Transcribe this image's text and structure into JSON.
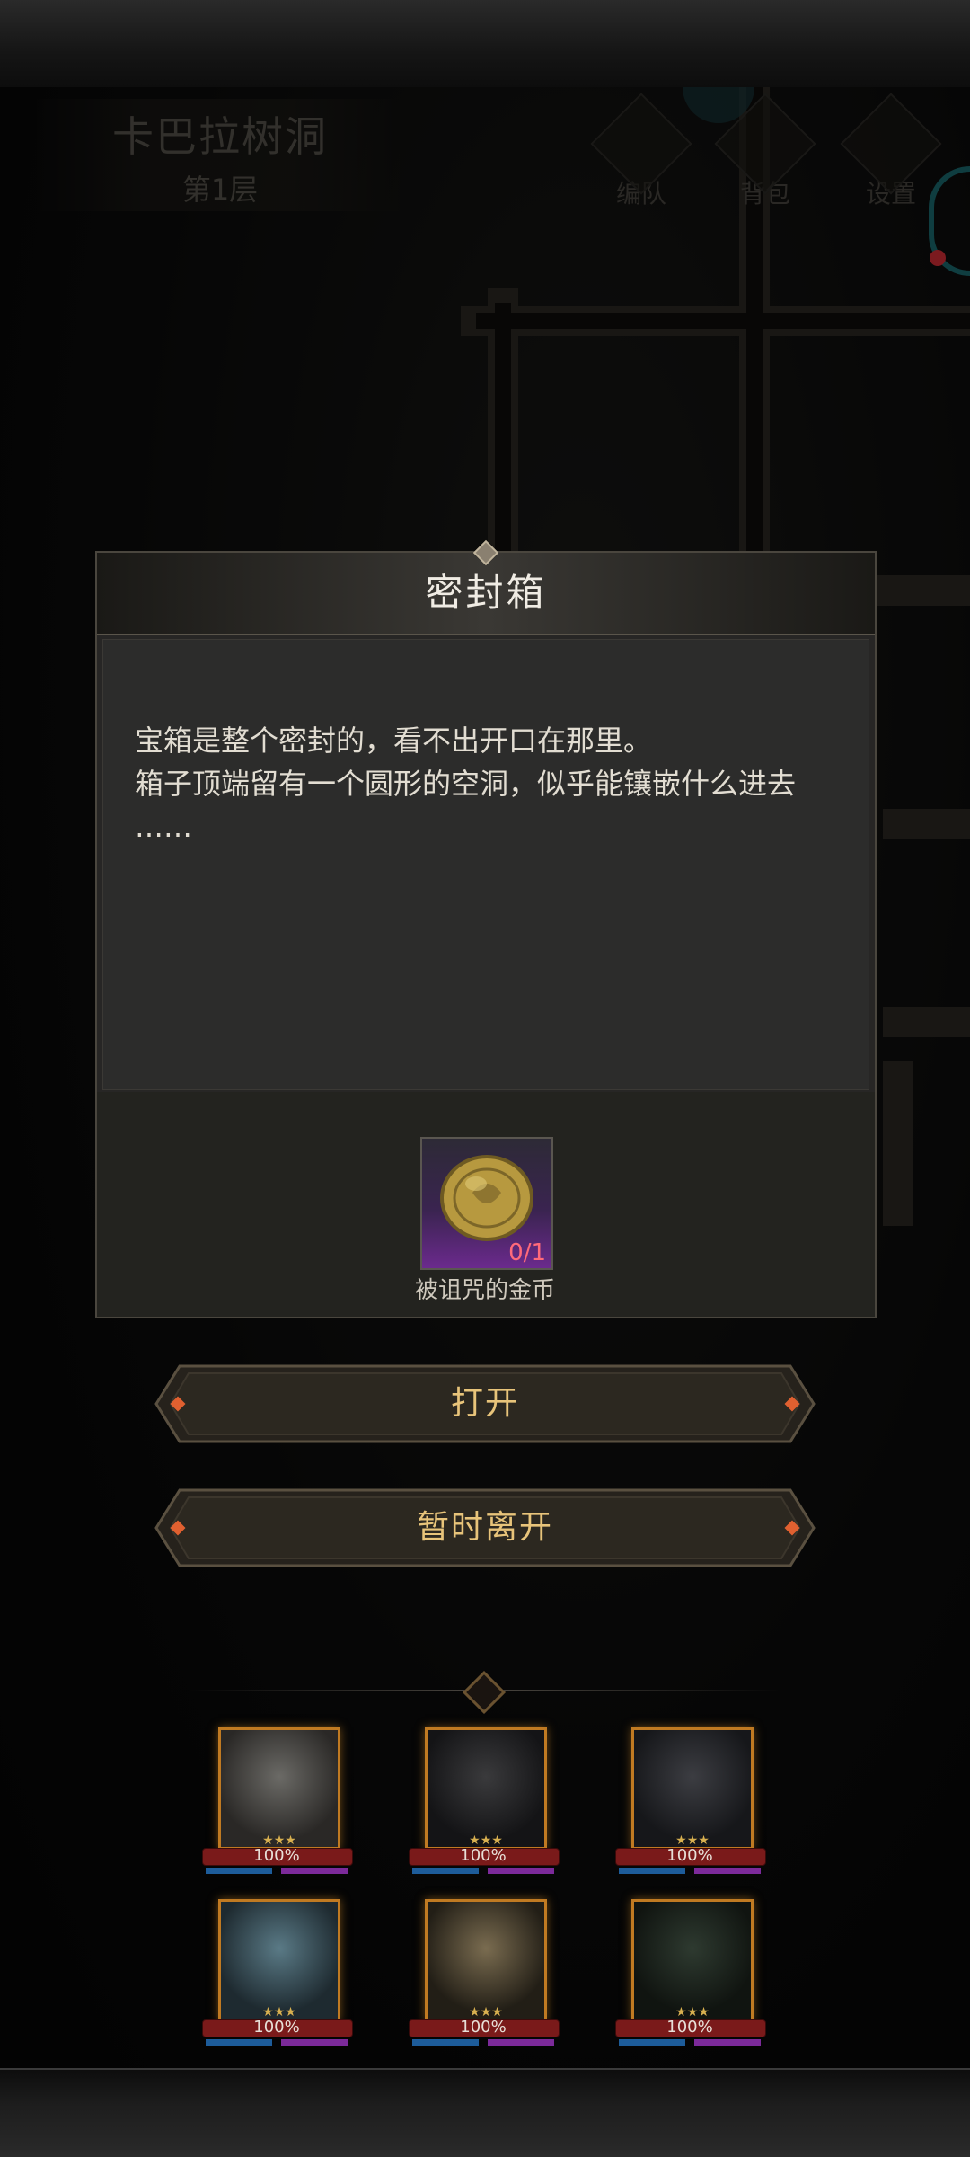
{
  "location": {
    "name": "卡巴拉树洞",
    "floor": "第1层"
  },
  "top_menu": [
    {
      "label": "编队",
      "icon": "helmet-icon"
    },
    {
      "label": "背包",
      "icon": "bag-icon"
    },
    {
      "label": "设置",
      "icon": "gear-icon"
    }
  ],
  "dialog": {
    "title": "密封箱",
    "description": "宝箱是整个密封的，看不出开口在那里。\n箱子顶端留有一个圆形的空洞，似乎能镶嵌什么进去\n……",
    "required_item": {
      "name": "被诅咒的金币",
      "count": "0/1",
      "icon": "gold-coin-icon"
    }
  },
  "buttons": {
    "open": "打开",
    "leave": "暂时离开"
  },
  "heroes": [
    {
      "hp": "100%",
      "stars": "★★★"
    },
    {
      "hp": "100%",
      "stars": "★★★"
    },
    {
      "hp": "100%",
      "stars": "★★★"
    },
    {
      "hp": "100%",
      "stars": "★★★"
    },
    {
      "hp": "100%",
      "stars": "★★★"
    },
    {
      "hp": "100%",
      "stars": "★★★"
    }
  ],
  "colors": {
    "accent_gold": "#e8c47a",
    "frame_orange": "#c07a22",
    "item_count": "#ff6a7a"
  }
}
